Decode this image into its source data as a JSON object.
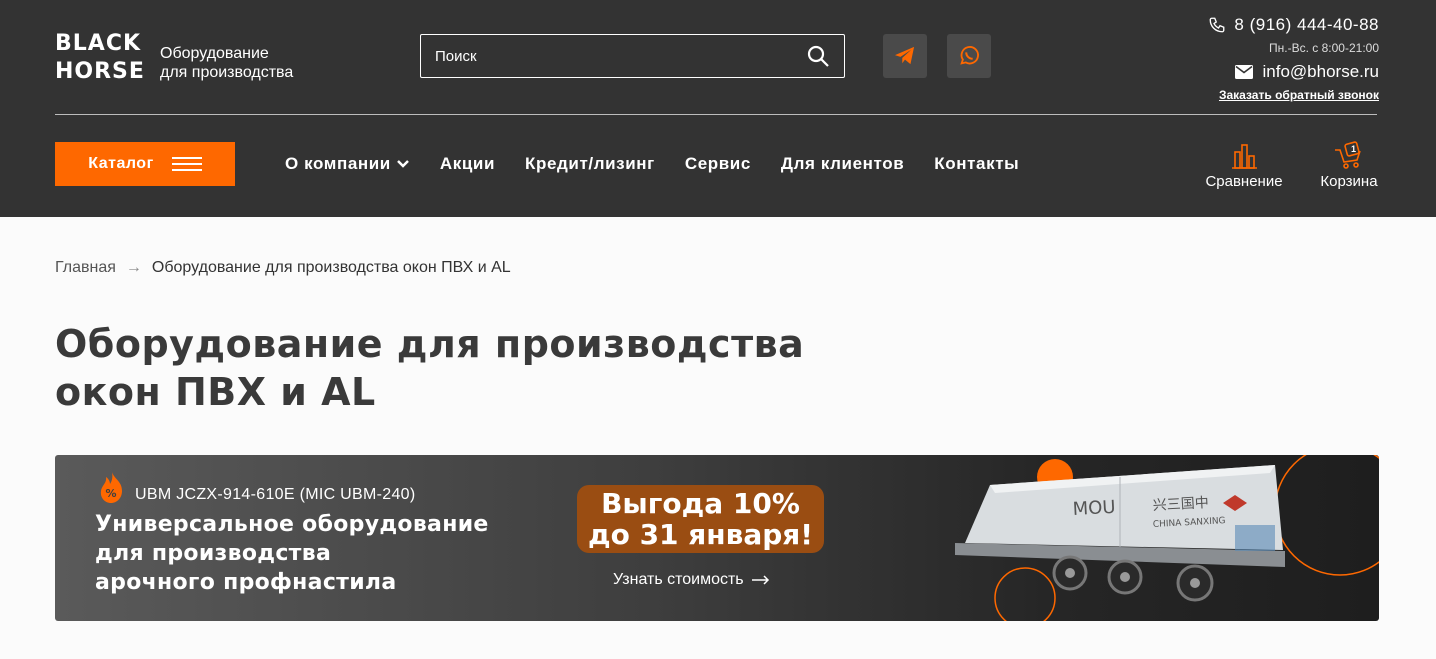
{
  "header": {
    "logo_line1": "BLACK",
    "logo_line2": "HORSE",
    "tagline_line1": "Оборудование",
    "tagline_line2": "для производства",
    "search_placeholder": "Поиск",
    "phone": "8 (916) 444-40-88",
    "hours": "Пн.-Вс. с 8:00-21:00",
    "email": "info@bhorse.ru",
    "callback": "Заказать обратный звонок"
  },
  "nav": {
    "catalog": "Каталог",
    "items": [
      "О компании",
      "Акции",
      "Кредит/лизинг",
      "Сервис",
      "Для клиентов",
      "Контакты"
    ],
    "compare": "Сравнение",
    "cart": "Корзина",
    "cart_count": "1"
  },
  "breadcrumb": {
    "home": "Главная",
    "separator": "→",
    "current": "Оборудование для производства окон ПВХ и AL"
  },
  "page": {
    "title_line1": "Оборудование для производства",
    "title_line2": "окон ПВХ и AL"
  },
  "banner": {
    "model": "UBM JCZX-914-610E (МІС UBM-240)",
    "headline_line1": "Универсальное оборудование",
    "headline_line2": "для производства",
    "headline_line3": "арочного профнастила",
    "promo_line1": "Выгода 10%",
    "promo_line2": "до 31 января!",
    "cta": "Узнать стоимость",
    "machine_brand": "MOU",
    "machine_text": "兴三国中",
    "machine_subtext": "CHINA SANXING"
  },
  "colors": {
    "accent": "#fe6800",
    "header_bg": "#333333",
    "promo_bg": "#9a4d12"
  }
}
